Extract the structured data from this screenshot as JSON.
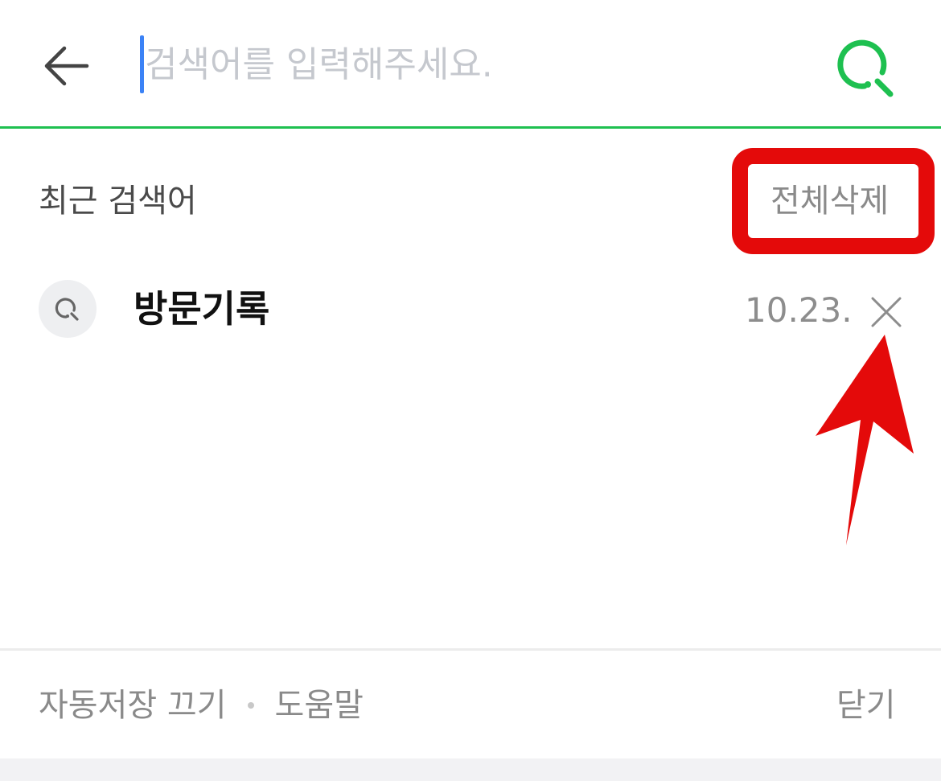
{
  "search": {
    "placeholder": "검색어를 입력해주세요.",
    "value": ""
  },
  "recent": {
    "title": "최근 검색어",
    "clear_all_label": "전체삭제",
    "items": [
      {
        "keyword": "방문기록",
        "date": "10.23."
      }
    ]
  },
  "footer": {
    "autosave_off_label": "자동저장 끄기",
    "help_label": "도움말",
    "close_label": "닫기"
  },
  "icons": {
    "back": "arrow-left-icon",
    "search_submit": "search-icon",
    "history_search": "search-icon",
    "delete": "close-icon"
  },
  "colors": {
    "accent": "#1ec050",
    "caret": "#3b82f6",
    "annotation": "#e40a0a"
  }
}
